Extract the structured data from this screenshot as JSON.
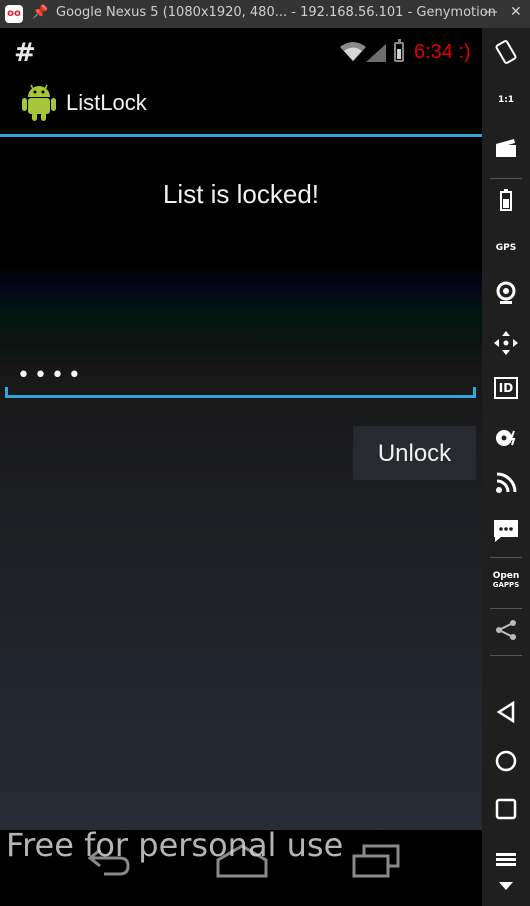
{
  "window": {
    "title": "Google Nexus 5 (1080x1920, 480... - 192.168.56.101 - Genymotion",
    "logo_text": "oo",
    "pin_icon": "pin-icon",
    "minimize": "—",
    "close": "✕"
  },
  "statusbar": {
    "notification": "#",
    "time": "6:34 :)",
    "time_color": "#e00000"
  },
  "actionbar": {
    "app_name": "ListLock",
    "accent": "#33a5d9"
  },
  "main": {
    "message": "List is locked!",
    "password_value": "abcd",
    "unlock_label": "Unlock"
  },
  "watermark": "Free for personal use",
  "sidebar": {
    "gps_label": "GPS",
    "id_label": "ID",
    "open_label": "Open",
    "gapps_label": "GAPPS",
    "fit_label": "1:1"
  }
}
